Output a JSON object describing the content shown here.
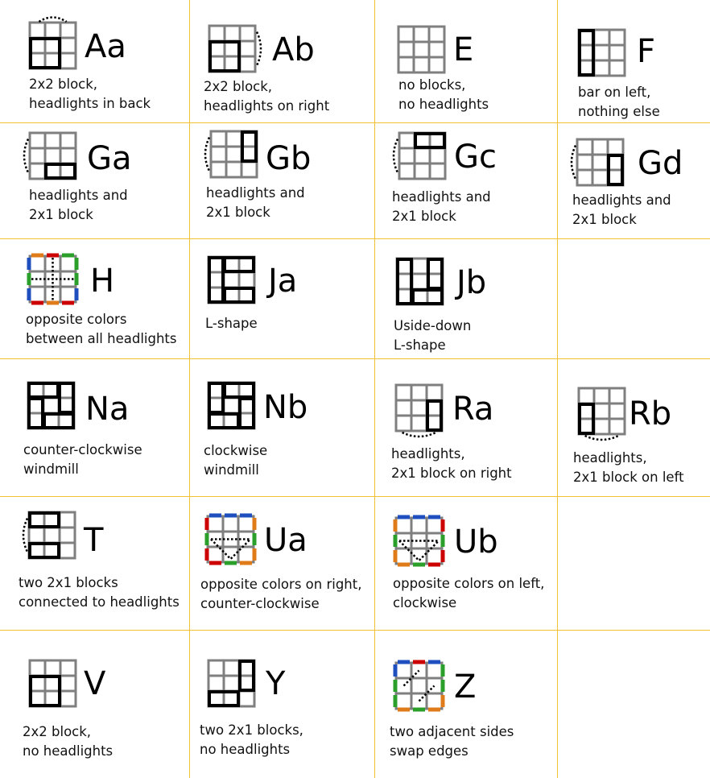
{
  "colors": {
    "grid_line": "#f1c232",
    "tile": "#7f7f7f",
    "block": "#000000",
    "red": "#cc0000",
    "blue": "#1f4fbf",
    "green": "#2aa02a",
    "orange": "#e07b1a"
  },
  "cases": [
    {
      "id": "Aa",
      "code": "Aa",
      "lines": [
        "2x2 block,",
        "headlights in back"
      ],
      "icon": "aa-icon"
    },
    {
      "id": "Ab",
      "code": "Ab",
      "lines": [
        "2x2 block,",
        "headlights on right"
      ],
      "icon": "ab-icon"
    },
    {
      "id": "E",
      "code": "E",
      "lines": [
        "no blocks,",
        "no headlights"
      ],
      "icon": "e-icon"
    },
    {
      "id": "F",
      "code": "F",
      "lines": [
        "bar on left,",
        "nothing else"
      ],
      "icon": "f-icon"
    },
    {
      "id": "Ga",
      "code": "Ga",
      "lines": [
        "headlights and",
        "2x1 block"
      ],
      "icon": "ga-icon"
    },
    {
      "id": "Gb",
      "code": "Gb",
      "lines": [
        "headlights and",
        "2x1 block"
      ],
      "icon": "gb-icon"
    },
    {
      "id": "Gc",
      "code": "Gc",
      "lines": [
        "headlights and",
        "2x1 block"
      ],
      "icon": "gc-icon"
    },
    {
      "id": "Gd",
      "code": "Gd",
      "lines": [
        "headlights and",
        "2x1 block"
      ],
      "icon": "gd-icon"
    },
    {
      "id": "H",
      "code": "H",
      "lines": [
        "opposite colors",
        "between all headlights"
      ],
      "icon": "h-icon"
    },
    {
      "id": "Ja",
      "code": "Ja",
      "lines": [
        "L-shape"
      ],
      "icon": "ja-icon"
    },
    {
      "id": "Jb",
      "code": "Jb",
      "lines": [
        "Uside-down",
        "L-shape"
      ],
      "icon": "jb-icon"
    },
    {
      "id": "Na",
      "code": "Na",
      "lines": [
        "counter-clockwise",
        "windmill"
      ],
      "icon": "na-icon"
    },
    {
      "id": "Nb",
      "code": "Nb",
      "lines": [
        "clockwise",
        "windmill"
      ],
      "icon": "nb-icon"
    },
    {
      "id": "Ra",
      "code": "Ra",
      "lines": [
        "headlights,",
        "2x1 block on right"
      ],
      "icon": "ra-icon"
    },
    {
      "id": "Rb",
      "code": "Rb",
      "lines": [
        "headlights,",
        "2x1 block on left"
      ],
      "icon": "rb-icon"
    },
    {
      "id": "T",
      "code": "T",
      "lines": [
        "two 2x1 blocks",
        "connected to headlights"
      ],
      "icon": "t-icon"
    },
    {
      "id": "Ua",
      "code": "Ua",
      "lines": [
        "opposite colors on right,",
        "counter-clockwise"
      ],
      "icon": "ua-icon"
    },
    {
      "id": "Ub",
      "code": "Ub",
      "lines": [
        "opposite colors on left,",
        "clockwise"
      ],
      "icon": "ub-icon"
    },
    {
      "id": "V",
      "code": "V",
      "lines": [
        "2x2 block,",
        "no headlights"
      ],
      "icon": "v-icon"
    },
    {
      "id": "Y",
      "code": "Y",
      "lines": [
        "two 2x1 blocks,",
        "no headlights"
      ],
      "icon": "y-icon"
    },
    {
      "id": "Z",
      "code": "Z",
      "lines": [
        "two adjacent sides",
        "swap edges"
      ],
      "icon": "z-icon"
    }
  ]
}
